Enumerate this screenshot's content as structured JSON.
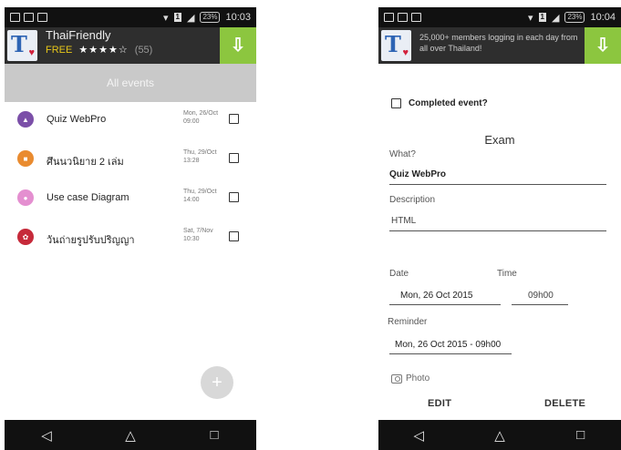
{
  "left_screen": {
    "status_bar": {
      "battery": "23%",
      "time": "10:03"
    },
    "ad": {
      "title": "ThaiFriendly",
      "free": "FREE",
      "stars": "★★★★☆",
      "count": "(55)",
      "icon": "download-arrow"
    },
    "app_bar_title": "All events",
    "events": [
      {
        "title": "Quiz WebPro",
        "date": "Mon, 26/Oct",
        "time": "09:00",
        "color": "#7b4fa8",
        "icon": "triangle"
      },
      {
        "title": "ศึนนวนิยาย 2 เล่ม",
        "date": "Thu, 29/Oct",
        "time": "13:28",
        "color": "#e98b2f",
        "icon": "note"
      },
      {
        "title": "Use case Diagram",
        "date": "Thu, 29/Oct",
        "time": "14:00",
        "color": "#e48fd0",
        "icon": "circle"
      },
      {
        "title": "วันถ่ายรูปรับปริญญา",
        "date": "Sat, 7/Nov",
        "time": "10:30",
        "color": "#c62a3a",
        "icon": "flower"
      }
    ],
    "fab_label": "+",
    "nav": {
      "back": "◁",
      "home": "△",
      "recent": "□"
    }
  },
  "right_screen": {
    "status_bar": {
      "battery": "23%",
      "time": "10:04"
    },
    "ad": {
      "text": "25,000+ members logging in each day from all over Thailand!"
    },
    "completed_label": "Completed event?",
    "form_title": "Exam",
    "what_label": "What?",
    "what_value": "Quiz WebPro",
    "description_label": "Description",
    "description_value": "HTML",
    "date_label": "Date",
    "date_value": "Mon, 26 Oct 2015",
    "time_label": "Time",
    "time_value": "09h00",
    "reminder_label": "Reminder",
    "reminder_value": "Mon, 26 Oct 2015 - 09h00",
    "photo_label": "Photo",
    "edit_label": "EDIT",
    "delete_label": "DELETE",
    "nav": {
      "back": "◁",
      "home": "△",
      "recent": "□"
    }
  }
}
